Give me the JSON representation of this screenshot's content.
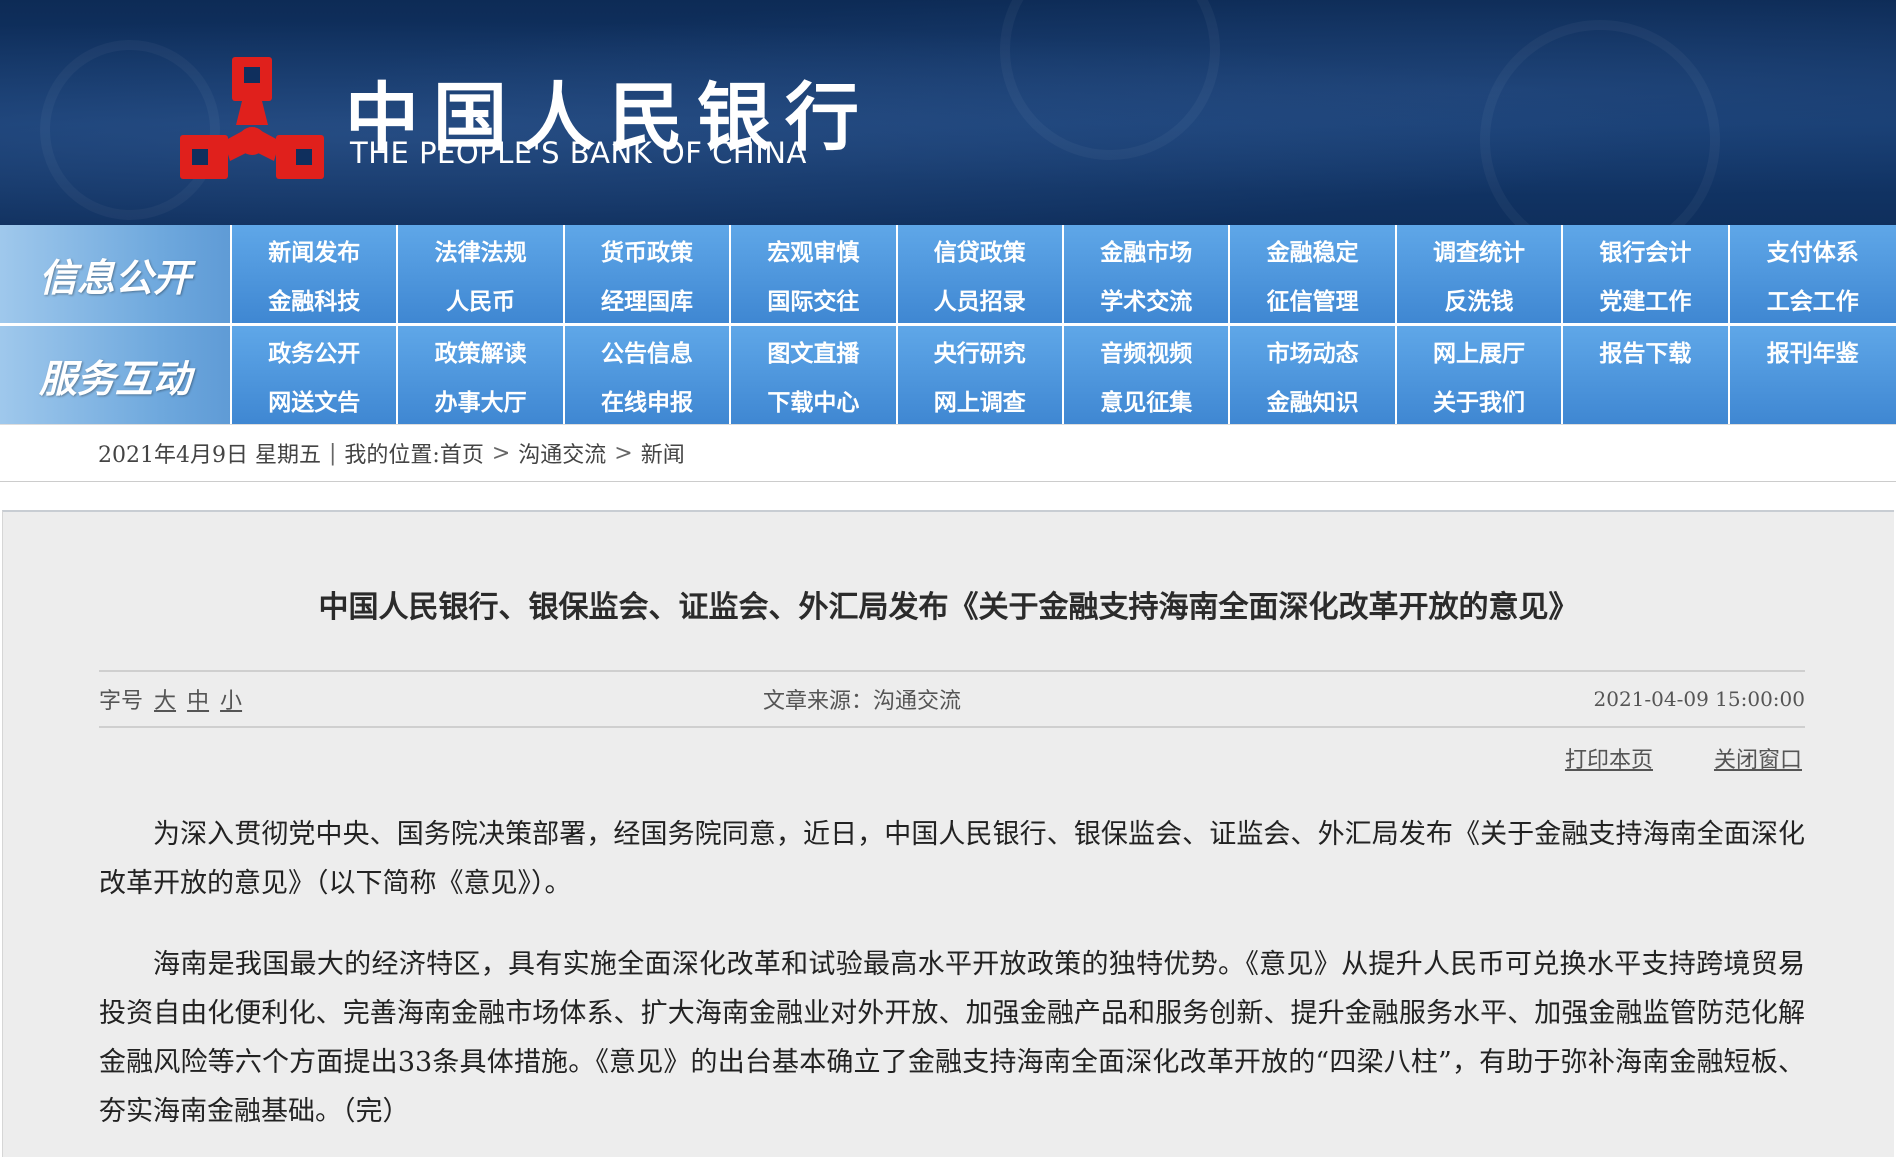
{
  "header": {
    "logo_cn": "中国人民银行",
    "logo_en": "THE PEOPLE'S BANK OF CHINA",
    "logo_color": "#e0201c"
  },
  "nav": [
    {
      "label": "信息公开",
      "items": [
        "新闻发布",
        "法律法规",
        "货币政策",
        "宏观审慎",
        "信贷政策",
        "金融市场",
        "金融稳定",
        "调查统计",
        "银行会计",
        "支付体系",
        "金融科技",
        "人民币",
        "经理国库",
        "国际交往",
        "人员招录",
        "学术交流",
        "征信管理",
        "反洗钱",
        "党建工作",
        "工会工作"
      ]
    },
    {
      "label": "服务互动",
      "items": [
        "政务公开",
        "政策解读",
        "公告信息",
        "图文直播",
        "央行研究",
        "音频视频",
        "市场动态",
        "网上展厅",
        "报告下载",
        "报刊年鉴",
        "网送文告",
        "办事大厅",
        "在线申报",
        "下载中心",
        "网上调查",
        "意见征集",
        "金融知识",
        "关于我们",
        "",
        ""
      ]
    }
  ],
  "breadcrumb": {
    "date": "2021年4月9日 星期五",
    "position_label": "我的位置:",
    "items": [
      "首页",
      "沟通交流",
      "新闻"
    ]
  },
  "article": {
    "title": "中国人民银行、银保监会、证监会、外汇局发布《关于金融支持海南全面深化改革开放的意见》",
    "font_size_label": "字号",
    "font_sizes": [
      "大",
      "中",
      "小"
    ],
    "source": "文章来源：沟通交流",
    "datetime": "2021-04-09 15:00:00",
    "print_label": "打印本页",
    "close_label": "关闭窗口",
    "paragraphs": [
      "为深入贯彻党中央、国务院决策部署，经国务院同意，近日，中国人民银行、银保监会、证监会、外汇局发布《关于金融支持海南全面深化改革开放的意见》（以下简称《意见》）。",
      "海南是我国最大的经济特区，具有实施全面深化改革和试验最高水平开放政策的独特优势。《意见》从提升人民币可兑换水平支持跨境贸易投资自由化便利化、完善海南金融市场体系、扩大海南金融业对外开放、加强金融产品和服务创新、提升金融服务水平、加强金融监管防范化解金融风险等六个方面提出33条具体措施。《意见》的出台基本确立了金融支持海南全面深化改革开放的“四梁八柱”，有助于弥补海南金融短板、夯实海南金融基础。（完）"
    ]
  }
}
